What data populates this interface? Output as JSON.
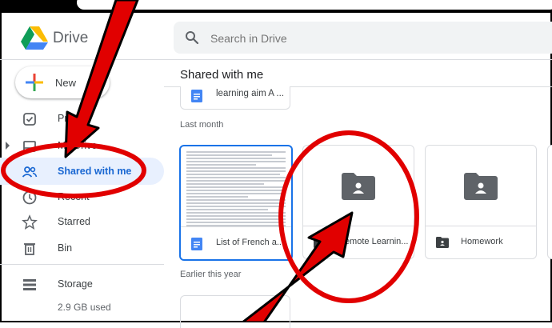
{
  "app": {
    "name": "Drive",
    "logo_icon": "google-drive-logo"
  },
  "search": {
    "placeholder": "Search in Drive"
  },
  "sidebar": {
    "new_label": "New",
    "items": [
      {
        "label": "Priority",
        "icon": "priority-icon"
      },
      {
        "label": "My Drive",
        "icon": "my-drive-icon"
      },
      {
        "label": "Shared with me",
        "icon": "shared-icon",
        "active": true
      },
      {
        "label": "Recent",
        "icon": "clock-icon"
      },
      {
        "label": "Starred",
        "icon": "star-icon"
      },
      {
        "label": "Bin",
        "icon": "trash-icon"
      }
    ],
    "storage": {
      "label": "Storage",
      "used": "2.9 GB used",
      "icon": "storage-icon"
    }
  },
  "main": {
    "title": "Shared with me",
    "top_file": {
      "name": "learning aim A ...",
      "icon": "doc-icon"
    },
    "sections": {
      "last_month": "Last month",
      "earlier": "Earlier this year"
    },
    "cards": [
      {
        "name": "List of French a...",
        "icon": "doc-icon",
        "selected": true
      },
      {
        "name": "Remote Learnin...",
        "icon": "shared-folder-icon"
      },
      {
        "name": "Homework",
        "icon": "shared-folder-icon"
      }
    ]
  },
  "colors": {
    "accent": "#1967d2",
    "active_bg": "#e8f0fe",
    "annotation": "#ff0000",
    "doc_blue": "#4285f4",
    "folder_gray": "#5f6368"
  }
}
